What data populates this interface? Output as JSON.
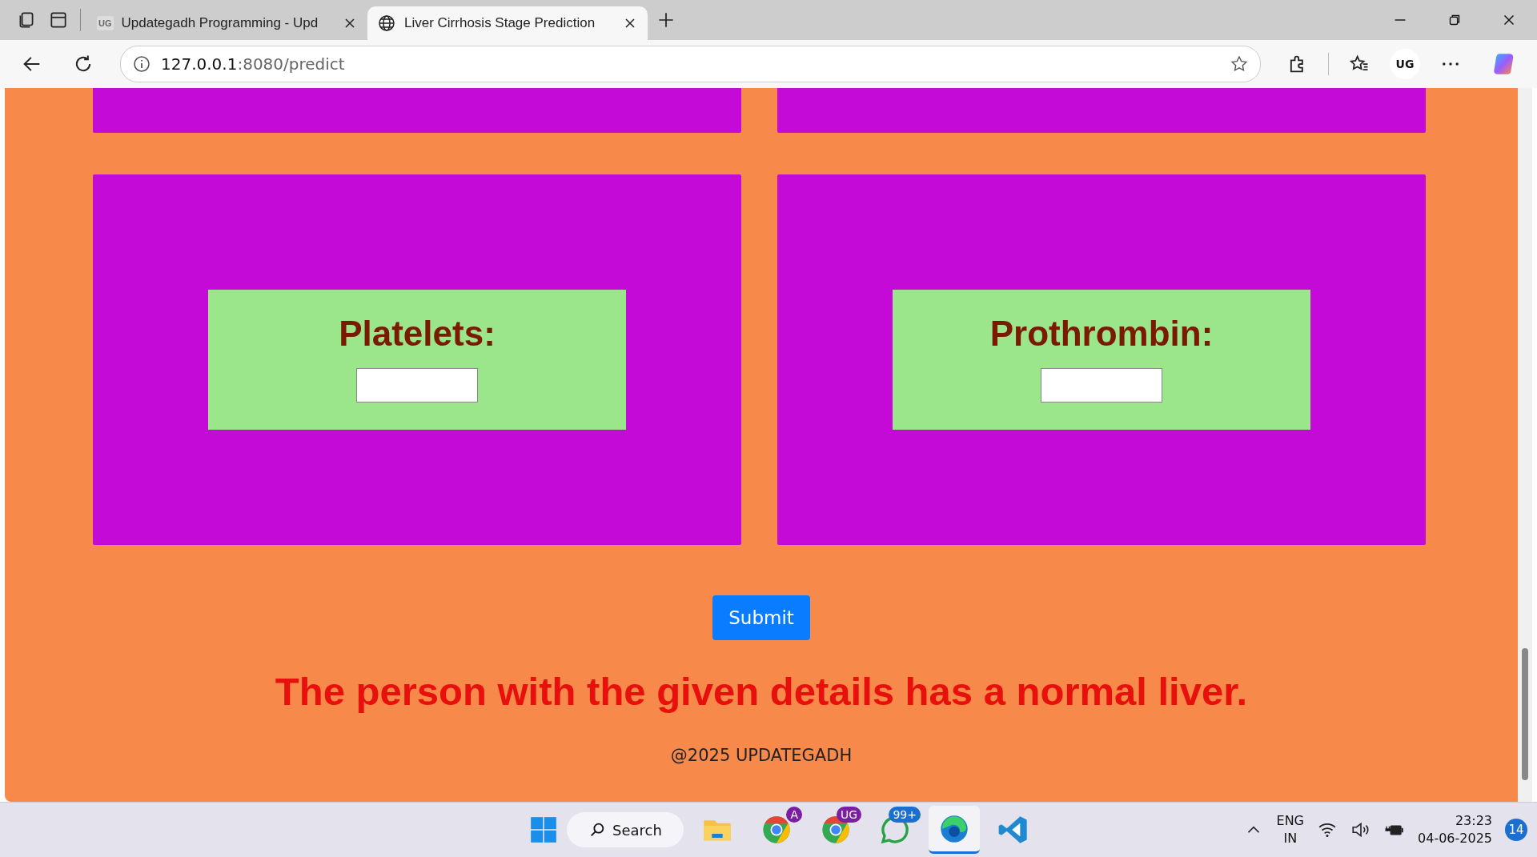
{
  "browser": {
    "tabs": [
      {
        "title": "Updategadh Programming - Upd",
        "favicon": "UG",
        "selected": false
      },
      {
        "title": "Liver Cirrhosis Stage Prediction",
        "selected": true
      }
    ],
    "address": {
      "host": "127.0.0.1",
      "path": ":8080/predict"
    },
    "profile": "UG"
  },
  "form": {
    "fields": [
      {
        "label": "Platelets:"
      },
      {
        "label": "Prothrombin:"
      }
    ],
    "submit": "Submit"
  },
  "result": "The person with the given details has a normal liver.",
  "footer": "@2025 UPDATEGADH",
  "taskbar": {
    "search": "Search",
    "apps": [
      {
        "kind": "folder",
        "active": false
      },
      {
        "kind": "chrome",
        "badge": "A",
        "active": false
      },
      {
        "kind": "chrome",
        "badge": "UG",
        "active": false
      },
      {
        "kind": "whatsapp",
        "badge": "99+",
        "active": false
      },
      {
        "kind": "edge",
        "active": true
      },
      {
        "kind": "vscode",
        "active": false
      }
    ],
    "language": "ENG",
    "region": "IN",
    "time": "23:23",
    "date": "04-06-2025",
    "notifications": "14"
  }
}
